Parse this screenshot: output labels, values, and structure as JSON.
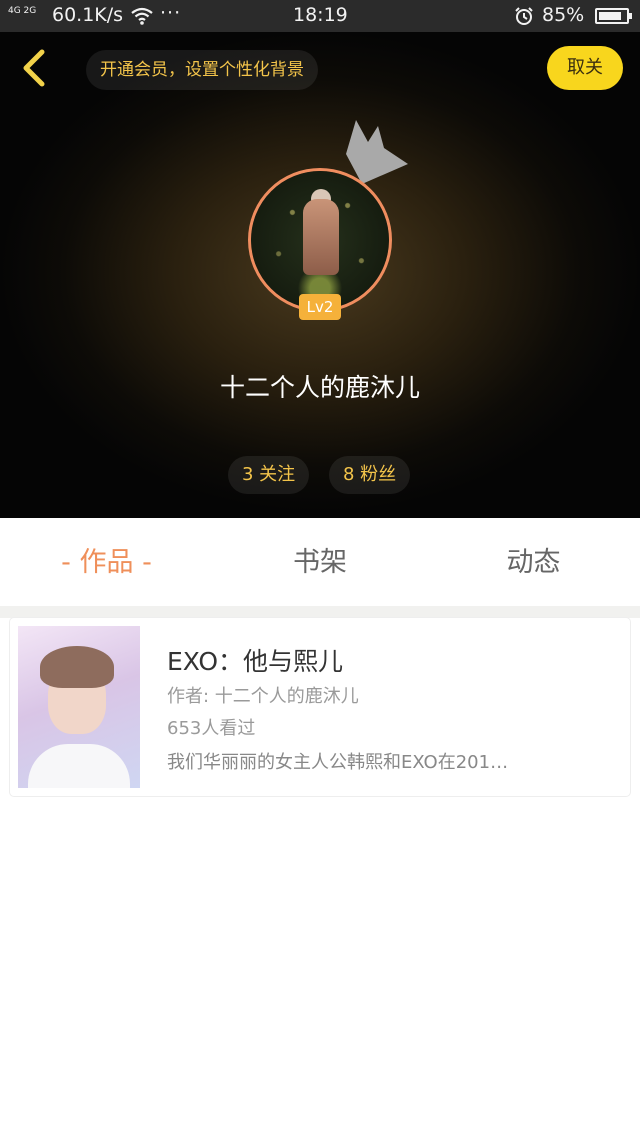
{
  "status_bar": {
    "signal": "4G 2G",
    "net_speed": "60.1K/s",
    "overflow": "···",
    "time": "18:19",
    "battery": "85%",
    "battery_level": 0.85
  },
  "header": {
    "vip_banner": "开通会员，设置个性化背景",
    "unfollow_label": "取关",
    "level_badge": "Lv2",
    "user_name": "十二个人的鹿沐儿",
    "following": "3 关注",
    "followers": "8 粉丝"
  },
  "tabs": [
    {
      "label": "- 作品 -",
      "active": true
    },
    {
      "label": "书架",
      "active": false
    },
    {
      "label": "动态",
      "active": false
    }
  ],
  "works": [
    {
      "title": "EXO：他与熙儿",
      "author": "作者: 十二个人的鹿沐儿",
      "views": "653人看过",
      "summary": "我们华丽丽的女主人公韩熙和EXO在201…"
    }
  ],
  "colors": {
    "accent_orange": "#ef8f5a",
    "gold_text": "#f3c44a",
    "unfollow_yellow": "#f8d61d"
  },
  "icons": {
    "back": "chevron-left-icon",
    "wifi": "wifi-icon",
    "alarm": "alarm-icon",
    "crown": "crown-icon"
  }
}
